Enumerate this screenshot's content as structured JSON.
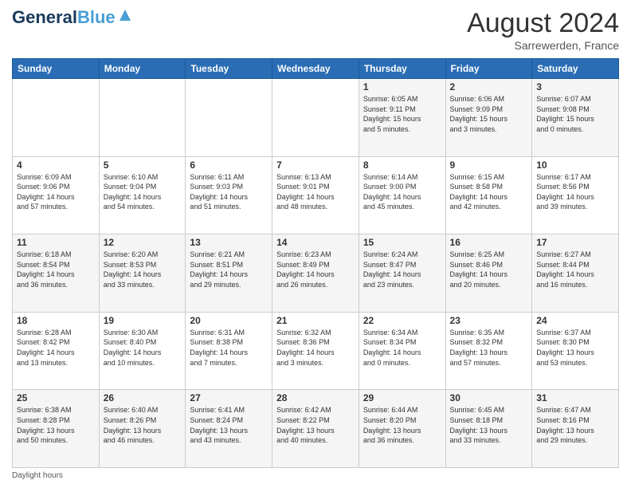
{
  "header": {
    "logo_line1_part1": "General",
    "logo_line1_part2": "Blue",
    "logo_sub": "",
    "month_year": "August 2024",
    "location": "Sarrewerden, France"
  },
  "days_of_week": [
    "Sunday",
    "Monday",
    "Tuesday",
    "Wednesday",
    "Thursday",
    "Friday",
    "Saturday"
  ],
  "weeks": [
    [
      {
        "day": "",
        "info": ""
      },
      {
        "day": "",
        "info": ""
      },
      {
        "day": "",
        "info": ""
      },
      {
        "day": "",
        "info": ""
      },
      {
        "day": "1",
        "info": "Sunrise: 6:05 AM\nSunset: 9:11 PM\nDaylight: 15 hours\nand 5 minutes."
      },
      {
        "day": "2",
        "info": "Sunrise: 6:06 AM\nSunset: 9:09 PM\nDaylight: 15 hours\nand 3 minutes."
      },
      {
        "day": "3",
        "info": "Sunrise: 6:07 AM\nSunset: 9:08 PM\nDaylight: 15 hours\nand 0 minutes."
      }
    ],
    [
      {
        "day": "4",
        "info": "Sunrise: 6:09 AM\nSunset: 9:06 PM\nDaylight: 14 hours\nand 57 minutes."
      },
      {
        "day": "5",
        "info": "Sunrise: 6:10 AM\nSunset: 9:04 PM\nDaylight: 14 hours\nand 54 minutes."
      },
      {
        "day": "6",
        "info": "Sunrise: 6:11 AM\nSunset: 9:03 PM\nDaylight: 14 hours\nand 51 minutes."
      },
      {
        "day": "7",
        "info": "Sunrise: 6:13 AM\nSunset: 9:01 PM\nDaylight: 14 hours\nand 48 minutes."
      },
      {
        "day": "8",
        "info": "Sunrise: 6:14 AM\nSunset: 9:00 PM\nDaylight: 14 hours\nand 45 minutes."
      },
      {
        "day": "9",
        "info": "Sunrise: 6:15 AM\nSunset: 8:58 PM\nDaylight: 14 hours\nand 42 minutes."
      },
      {
        "day": "10",
        "info": "Sunrise: 6:17 AM\nSunset: 8:56 PM\nDaylight: 14 hours\nand 39 minutes."
      }
    ],
    [
      {
        "day": "11",
        "info": "Sunrise: 6:18 AM\nSunset: 8:54 PM\nDaylight: 14 hours\nand 36 minutes."
      },
      {
        "day": "12",
        "info": "Sunrise: 6:20 AM\nSunset: 8:53 PM\nDaylight: 14 hours\nand 33 minutes."
      },
      {
        "day": "13",
        "info": "Sunrise: 6:21 AM\nSunset: 8:51 PM\nDaylight: 14 hours\nand 29 minutes."
      },
      {
        "day": "14",
        "info": "Sunrise: 6:23 AM\nSunset: 8:49 PM\nDaylight: 14 hours\nand 26 minutes."
      },
      {
        "day": "15",
        "info": "Sunrise: 6:24 AM\nSunset: 8:47 PM\nDaylight: 14 hours\nand 23 minutes."
      },
      {
        "day": "16",
        "info": "Sunrise: 6:25 AM\nSunset: 8:46 PM\nDaylight: 14 hours\nand 20 minutes."
      },
      {
        "day": "17",
        "info": "Sunrise: 6:27 AM\nSunset: 8:44 PM\nDaylight: 14 hours\nand 16 minutes."
      }
    ],
    [
      {
        "day": "18",
        "info": "Sunrise: 6:28 AM\nSunset: 8:42 PM\nDaylight: 14 hours\nand 13 minutes."
      },
      {
        "day": "19",
        "info": "Sunrise: 6:30 AM\nSunset: 8:40 PM\nDaylight: 14 hours\nand 10 minutes."
      },
      {
        "day": "20",
        "info": "Sunrise: 6:31 AM\nSunset: 8:38 PM\nDaylight: 14 hours\nand 7 minutes."
      },
      {
        "day": "21",
        "info": "Sunrise: 6:32 AM\nSunset: 8:36 PM\nDaylight: 14 hours\nand 3 minutes."
      },
      {
        "day": "22",
        "info": "Sunrise: 6:34 AM\nSunset: 8:34 PM\nDaylight: 14 hours\nand 0 minutes."
      },
      {
        "day": "23",
        "info": "Sunrise: 6:35 AM\nSunset: 8:32 PM\nDaylight: 13 hours\nand 57 minutes."
      },
      {
        "day": "24",
        "info": "Sunrise: 6:37 AM\nSunset: 8:30 PM\nDaylight: 13 hours\nand 53 minutes."
      }
    ],
    [
      {
        "day": "25",
        "info": "Sunrise: 6:38 AM\nSunset: 8:28 PM\nDaylight: 13 hours\nand 50 minutes."
      },
      {
        "day": "26",
        "info": "Sunrise: 6:40 AM\nSunset: 8:26 PM\nDaylight: 13 hours\nand 46 minutes."
      },
      {
        "day": "27",
        "info": "Sunrise: 6:41 AM\nSunset: 8:24 PM\nDaylight: 13 hours\nand 43 minutes."
      },
      {
        "day": "28",
        "info": "Sunrise: 6:42 AM\nSunset: 8:22 PM\nDaylight: 13 hours\nand 40 minutes."
      },
      {
        "day": "29",
        "info": "Sunrise: 6:44 AM\nSunset: 8:20 PM\nDaylight: 13 hours\nand 36 minutes."
      },
      {
        "day": "30",
        "info": "Sunrise: 6:45 AM\nSunset: 8:18 PM\nDaylight: 13 hours\nand 33 minutes."
      },
      {
        "day": "31",
        "info": "Sunrise: 6:47 AM\nSunset: 8:16 PM\nDaylight: 13 hours\nand 29 minutes."
      }
    ]
  ],
  "footer": {
    "label": "Daylight hours"
  }
}
